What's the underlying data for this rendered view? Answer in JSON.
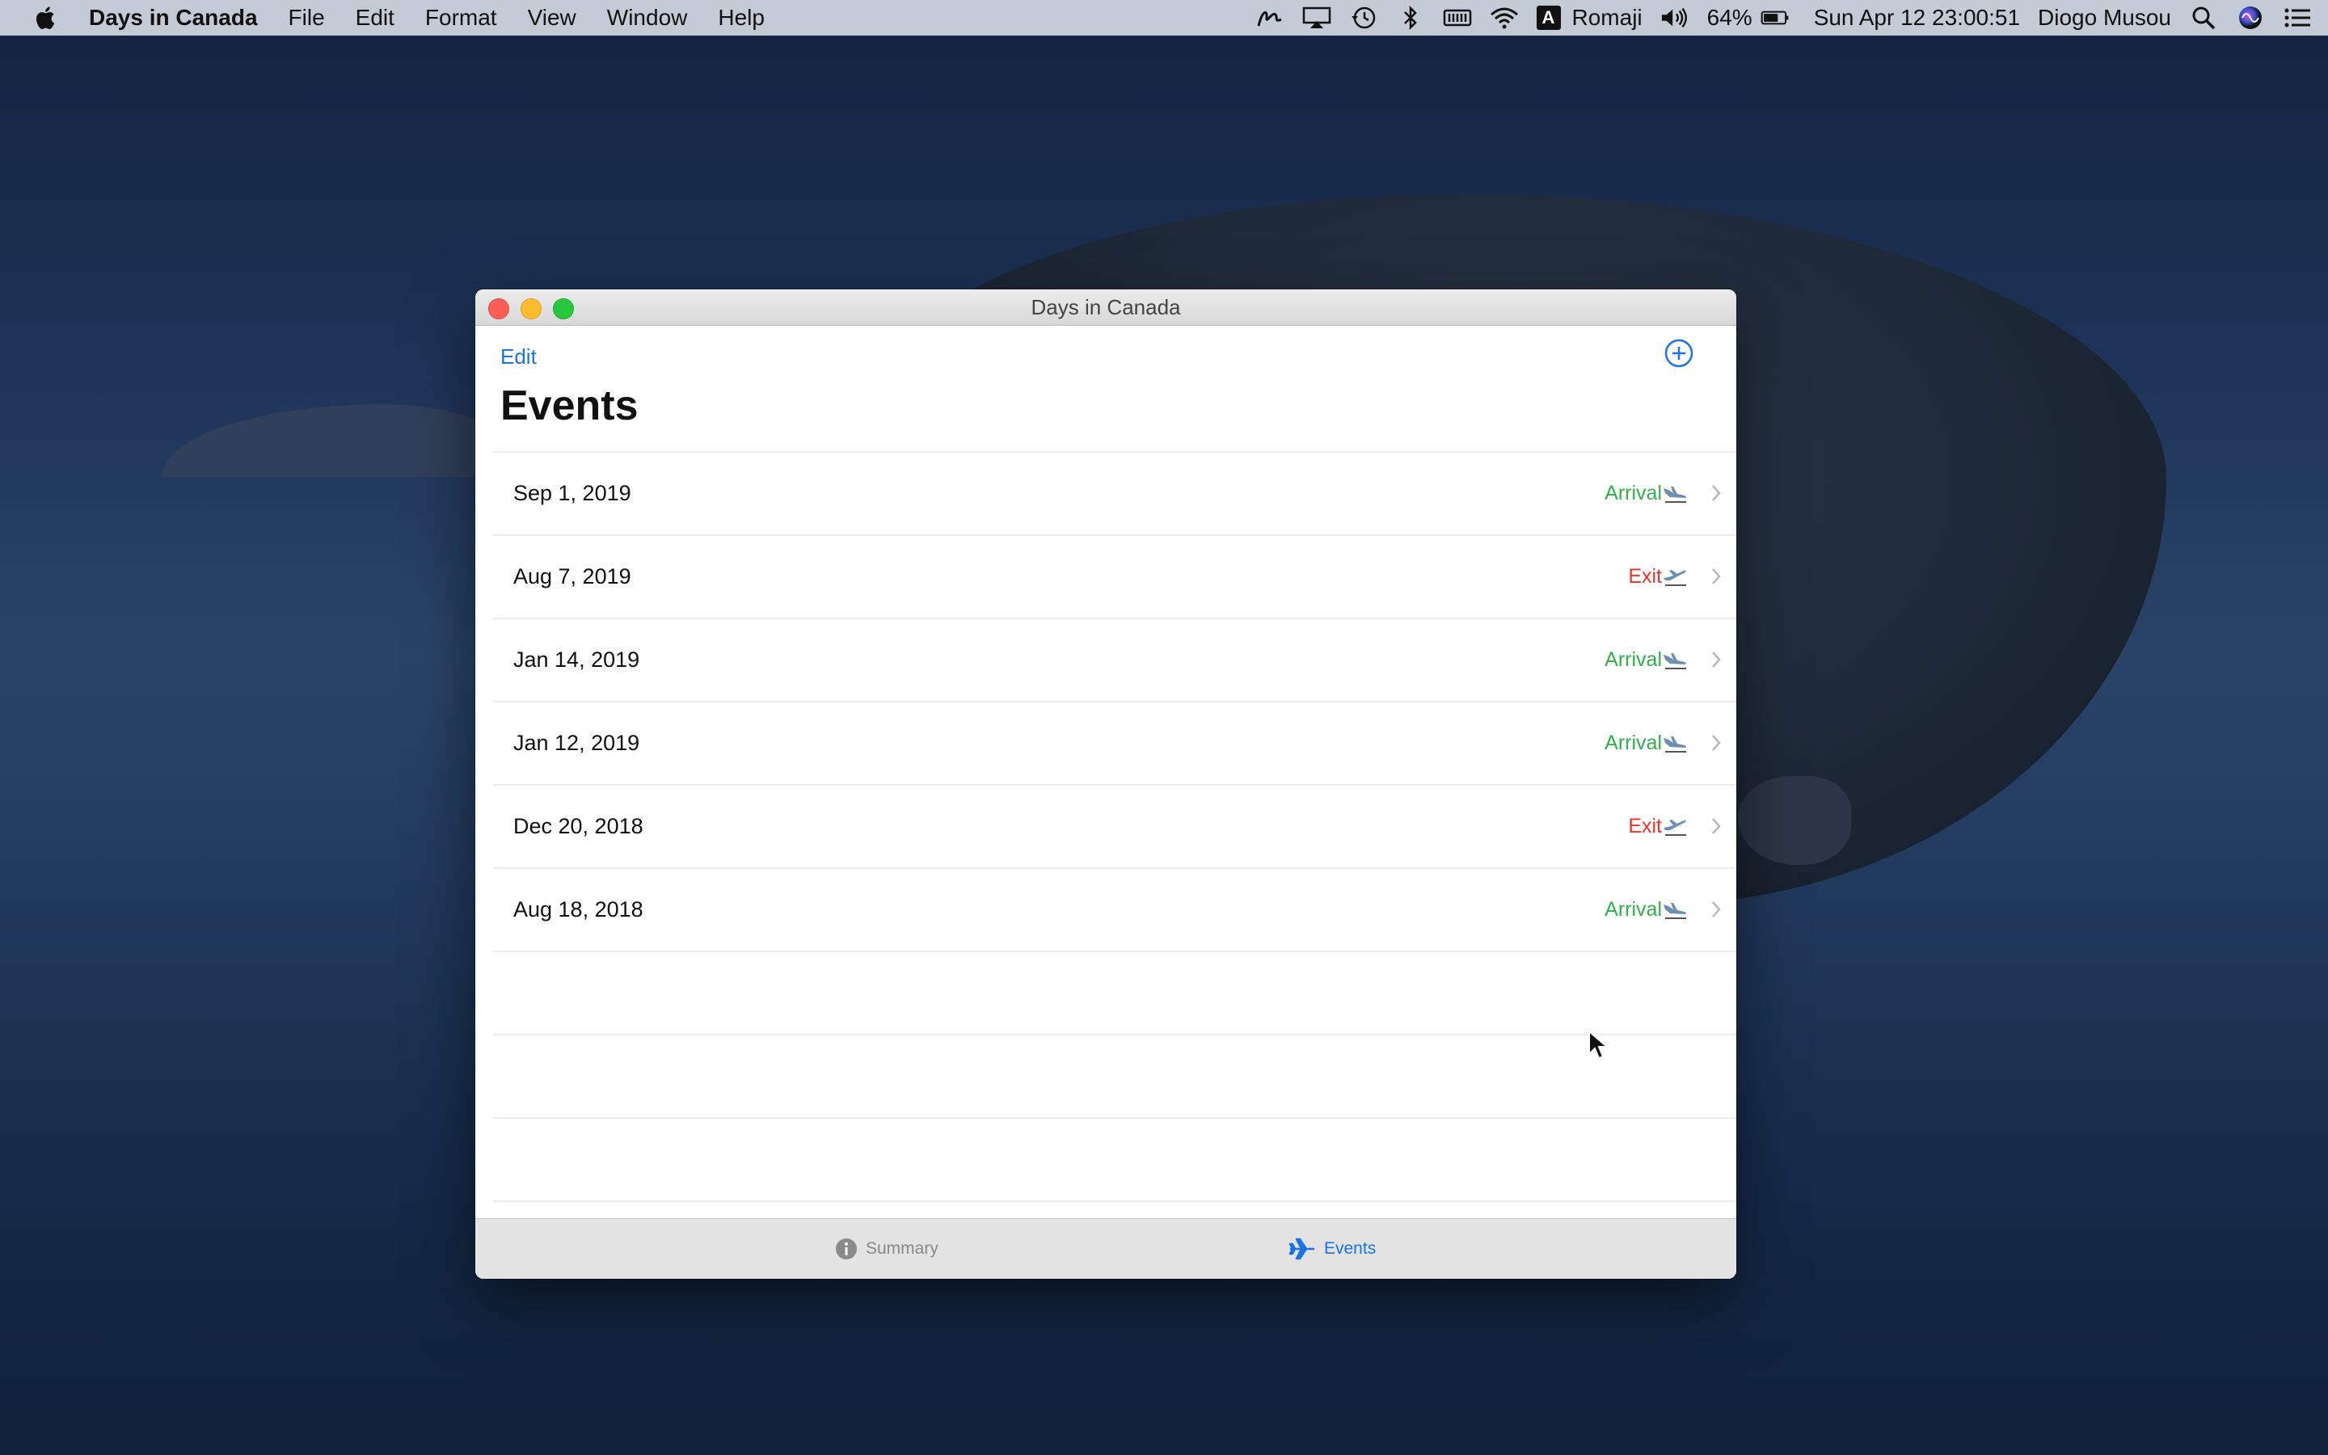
{
  "menubar": {
    "app_name": "Days in Canada",
    "menus": [
      "File",
      "Edit",
      "Format",
      "View",
      "Window",
      "Help"
    ],
    "input_method": "Romaji",
    "input_badge": "A",
    "battery": "64%",
    "datetime": "Sun Apr 12  23:00:51",
    "user": "Diogo Musou",
    "icons": [
      "signature-icon",
      "airplay-icon",
      "time-machine-icon",
      "bluetooth-icon",
      "keyboard-battery-icon",
      "wifi-icon",
      "volume-icon",
      "battery-icon",
      "spotlight-icon",
      "siri-icon",
      "notification-center-icon"
    ]
  },
  "window": {
    "title": "Days in Canada",
    "edit_label": "Edit",
    "add_icon": "plus-circle-icon",
    "heading": "Events",
    "events": [
      {
        "date": "Sep 1, 2019",
        "type": "Arrival",
        "kind": "arrival"
      },
      {
        "date": "Aug 7, 2019",
        "type": "Exit",
        "kind": "exit"
      },
      {
        "date": "Jan 14, 2019",
        "type": "Arrival",
        "kind": "arrival"
      },
      {
        "date": "Jan 12, 2019",
        "type": "Arrival",
        "kind": "arrival"
      },
      {
        "date": "Dec 20, 2018",
        "type": "Exit",
        "kind": "exit"
      },
      {
        "date": "Aug 18, 2018",
        "type": "Arrival",
        "kind": "arrival"
      }
    ],
    "tabs": [
      {
        "label": "Summary",
        "icon": "info-icon",
        "active": false
      },
      {
        "label": "Events",
        "icon": "airplane-icon",
        "active": true
      }
    ]
  },
  "colors": {
    "accent": "#1a73e8",
    "arrival": "#30b04a",
    "exit": "#f0312a"
  }
}
